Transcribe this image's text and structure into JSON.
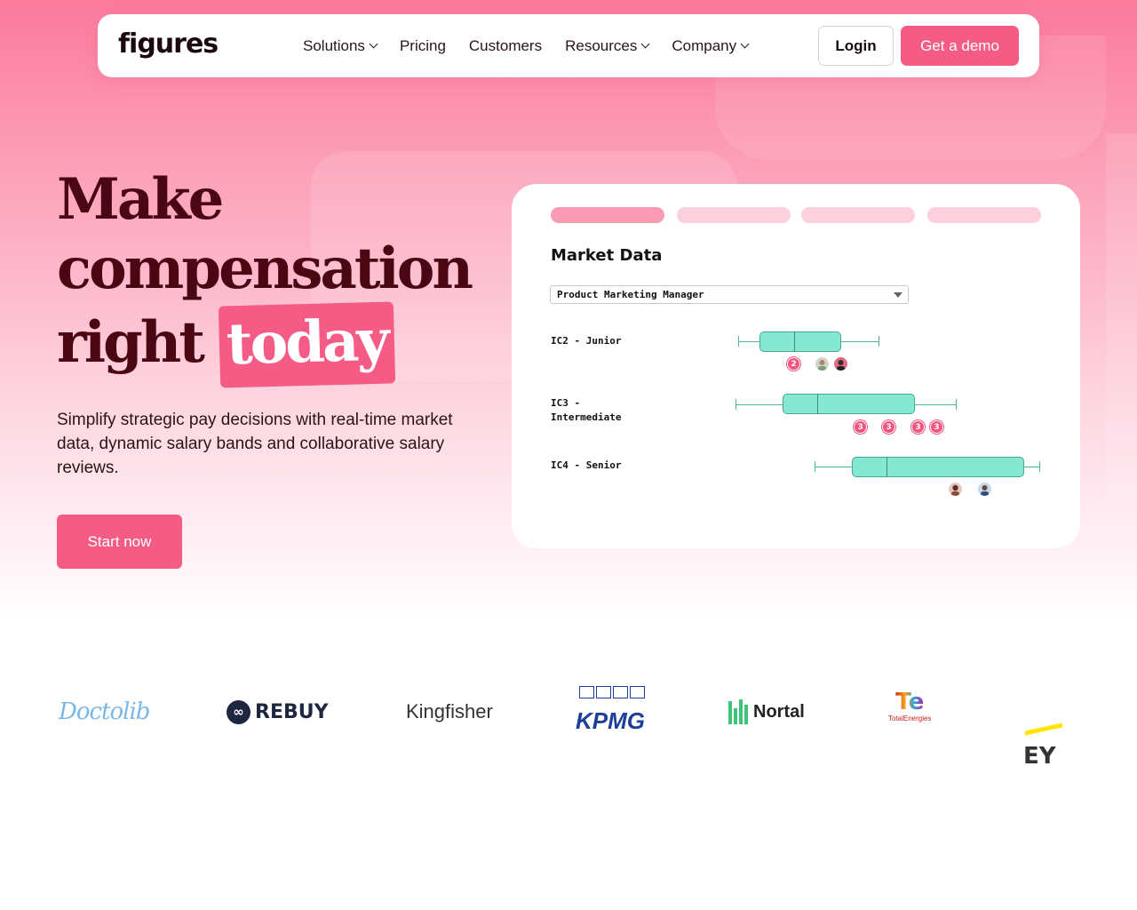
{
  "nav": {
    "logo_text": "figures",
    "links": [
      {
        "label": "Solutions",
        "has_dropdown": true
      },
      {
        "label": "Pricing",
        "has_dropdown": false
      },
      {
        "label": "Customers",
        "has_dropdown": false
      },
      {
        "label": "Resources",
        "has_dropdown": true
      },
      {
        "label": "Company",
        "has_dropdown": true
      }
    ],
    "login_label": "Login",
    "demo_label": "Get a demo"
  },
  "hero": {
    "headline_line1": "Make",
    "headline_line2": "compensation",
    "headline_line3_plain": "right",
    "headline_line3_highlight": "today",
    "subtext": "Simplify strategic pay decisions with real-time market data, dynamic salary bands and collaborative salary reviews.",
    "cta_label": "Start now"
  },
  "card": {
    "title": "Market Data",
    "select_value": "Product Marketing Manager",
    "rows": [
      {
        "label": "IC2 - Junior",
        "badges": [
          "2"
        ],
        "avatars": 2
      },
      {
        "label": "IC3 -\nIntermediate",
        "badges": [
          "3",
          "3",
          "3",
          "3"
        ],
        "avatars": 0
      },
      {
        "label": "IC4 - Senior",
        "badges": [],
        "avatars": 2
      }
    ]
  },
  "logos": {
    "doctolib": "Doctolib",
    "rebuy": "REBUY",
    "kingfisher": "Kingfisher",
    "kpmg": "KPMG",
    "nortal": "Nortal",
    "totalenergies_small": "TotalEnergies",
    "ey": "EY"
  },
  "colors": {
    "accent": "#f45c86",
    "headline": "#4a0612",
    "box_fill": "#84e8d2"
  }
}
